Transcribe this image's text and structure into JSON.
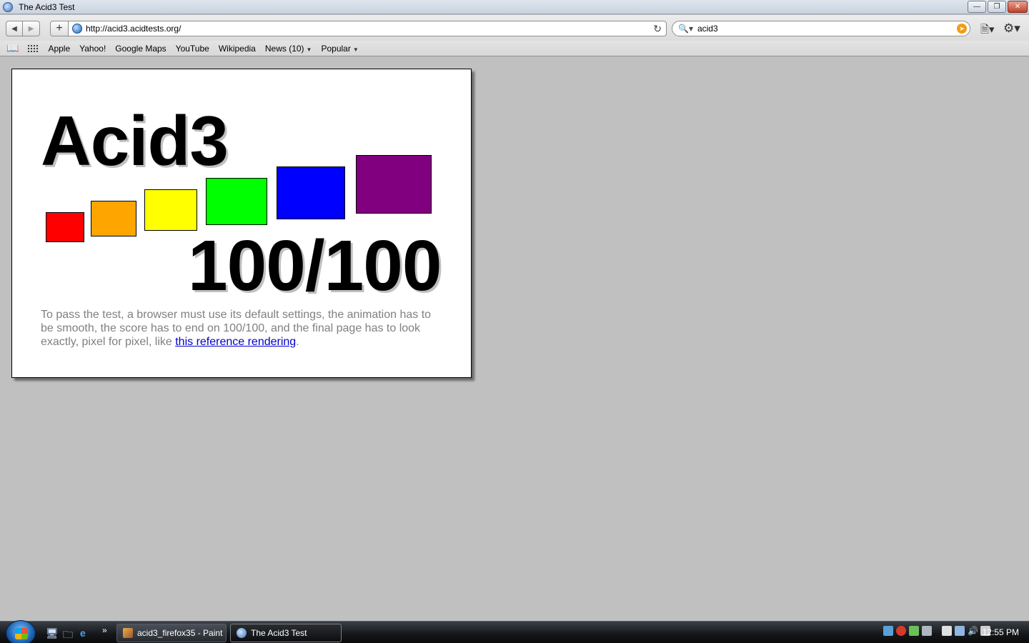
{
  "window": {
    "title": "The Acid3 Test"
  },
  "toolbar": {
    "url": "http://acid3.acidtests.org/",
    "search_value": "acid3"
  },
  "bookmarks": {
    "items": [
      {
        "label": "Apple"
      },
      {
        "label": "Yahoo!"
      },
      {
        "label": "Google Maps"
      },
      {
        "label": "YouTube"
      },
      {
        "label": "Wikipedia"
      },
      {
        "label": "News (10)"
      },
      {
        "label": "Popular"
      }
    ]
  },
  "content": {
    "title": "Acid3",
    "score": "100/100",
    "instructions_prefix": "To pass the test, a browser must use its default settings, the animation has to be smooth, the score has to end on 100/100, and the final page has to look exactly, pixel for pixel, like ",
    "link_text": "this reference rendering",
    "instructions_suffix": ".",
    "squares": [
      {
        "name": "red",
        "color": "#ff0000"
      },
      {
        "name": "orange",
        "color": "#ffa500"
      },
      {
        "name": "yellow",
        "color": "#ffff00"
      },
      {
        "name": "lime",
        "color": "#00ff00"
      },
      {
        "name": "blue",
        "color": "#0000ff"
      },
      {
        "name": "purple",
        "color": "#800080"
      }
    ]
  },
  "taskbar": {
    "tasks": [
      {
        "label": "acid3_firefox35 - Paint"
      },
      {
        "label": "The Acid3 Test"
      }
    ],
    "clock": "12:55 PM"
  }
}
